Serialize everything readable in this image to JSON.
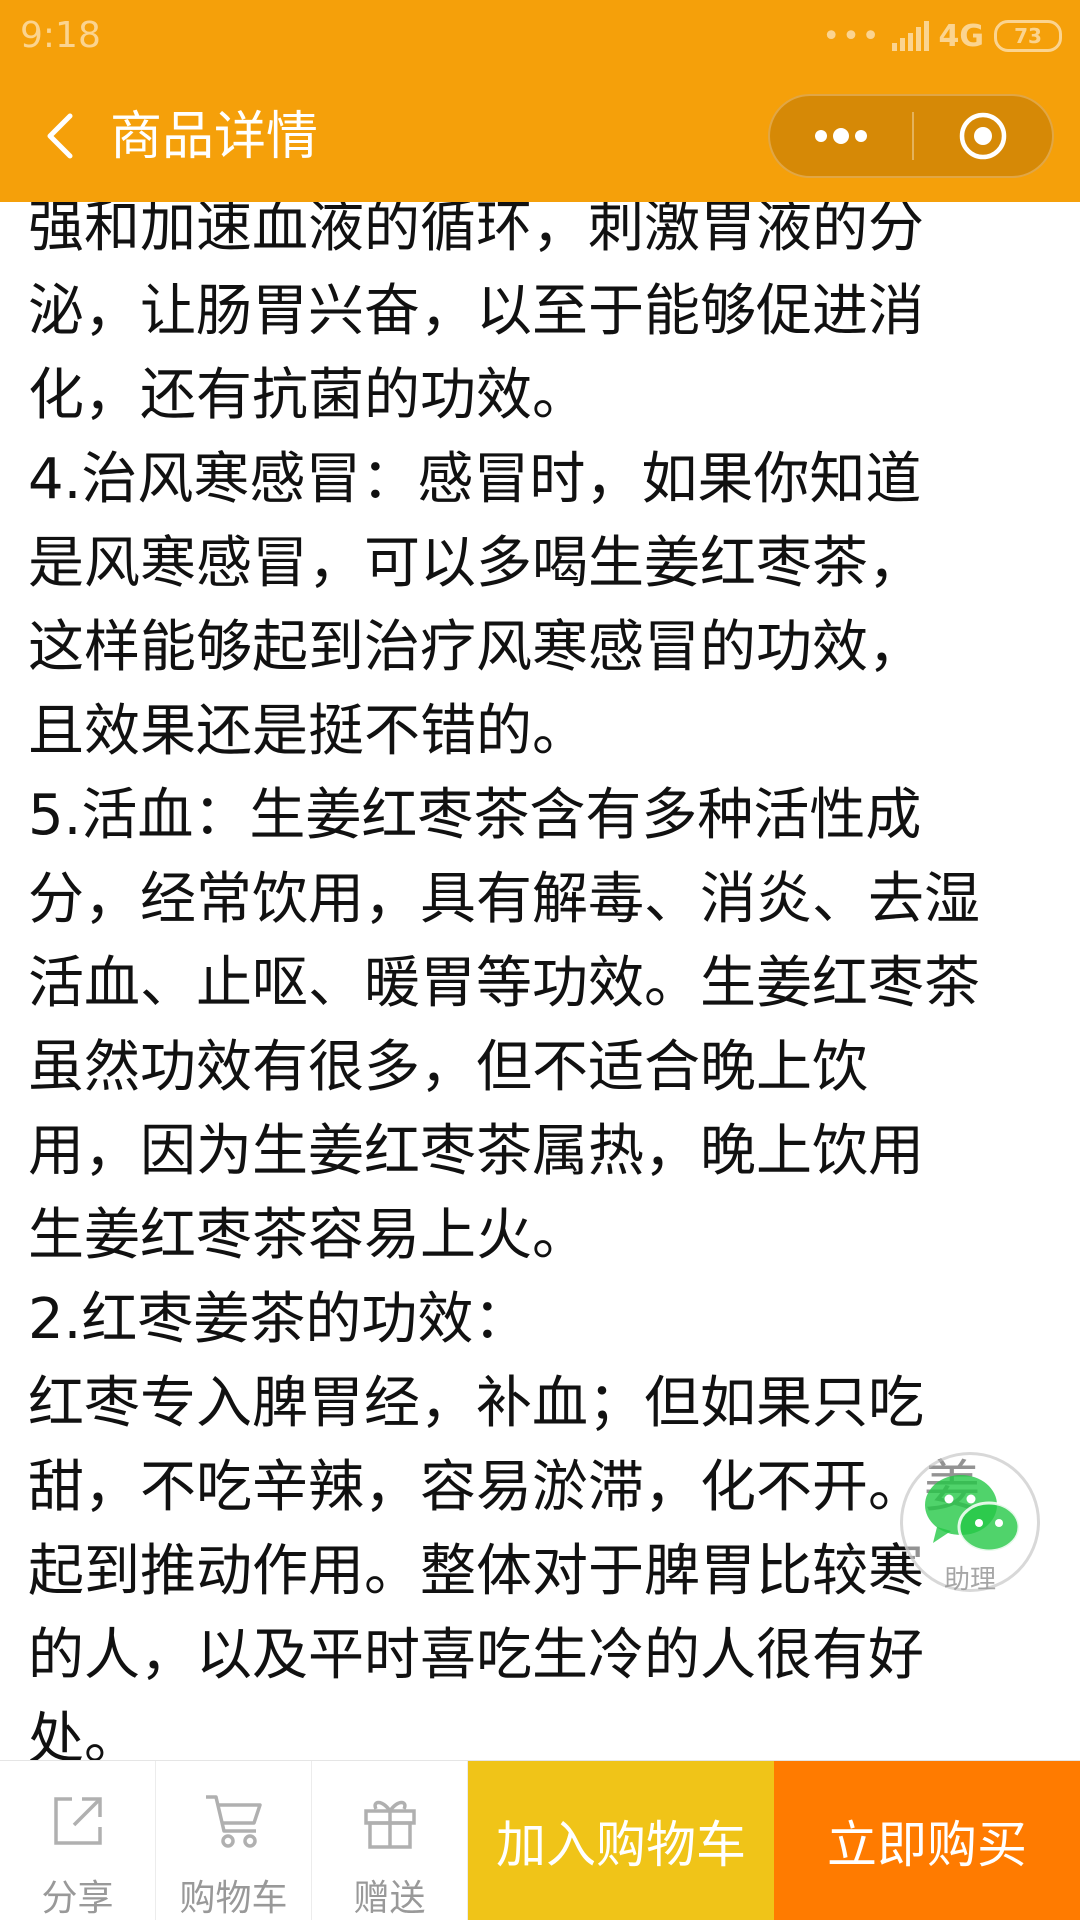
{
  "status_bar": {
    "time": "9:18",
    "dots": "•••",
    "network": "4G",
    "battery": "73"
  },
  "nav": {
    "title": "商品详情"
  },
  "content": {
    "lines": [
      "强和加速血液的循环，刺激胃液的分",
      "泌，让肠胃兴奋，以至于能够促进消",
      "化，还有抗菌的功效。",
      "4.治风寒感冒：感冒时，如果你知道",
      "是风寒感冒，可以多喝生姜红枣茶，",
      "这样能够起到治疗风寒感冒的功效，",
      "且效果还是挺不错的。",
      "5.活血：生姜红枣茶含有多种活性成",
      "分，经常饮用，具有解毒、消炎、去湿",
      "活血、止呕、暖胃等功效。生姜红枣茶",
      "虽然功效有很多，但不适合晚上饮",
      "用，因为生姜红枣茶属热，晚上饮用",
      "生姜红枣茶容易上火。",
      "2.红枣姜茶的功效：",
      "红枣专入脾胃经，补血；但如果只吃",
      "甜，不吃辛辣，容易淤滞，化不开。姜",
      "起到推动作用。整体对于脾胃比较寒",
      "的人，以及平时喜吃生冷的人很有好",
      "处。"
    ]
  },
  "float_helper": {
    "label": "助理",
    "icon": "wechat-icon"
  },
  "bottom_bar": {
    "share_label": "分享",
    "cart_label": "购物车",
    "gift_label": "赠送",
    "add_cart_label": "加入购物车",
    "buy_now_label": "立即购买"
  },
  "colors": {
    "header_bg": "#f5a00a",
    "add_cart_bg": "#f0c418",
    "buy_now_bg": "#ff7b00"
  }
}
